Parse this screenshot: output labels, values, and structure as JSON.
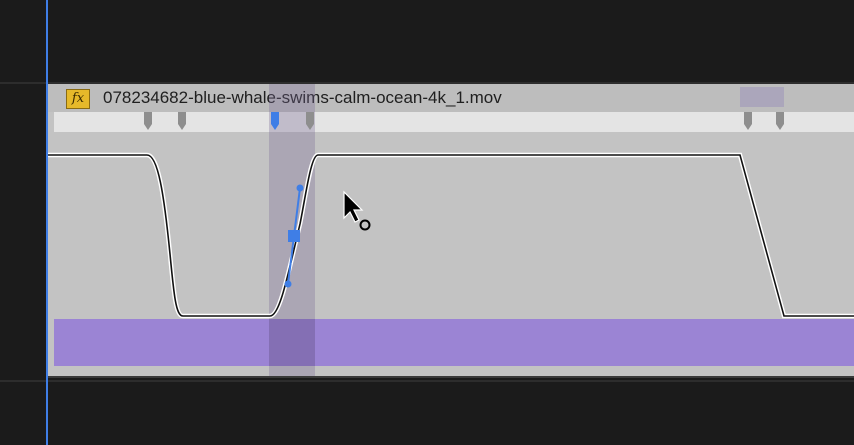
{
  "clip": {
    "name": "078234682-blue-whale-swims-calm-ocean-4k_1.mov",
    "fx_label": "fx",
    "colors": {
      "clip_body": "#c3c3c3",
      "keyframe_strip": "#e4e4e4",
      "audio_waveform": "#9b84d4",
      "fx_badge": "#e6b92a",
      "bezier_handle": "#3f7ee6",
      "playhead": "#3f7ee6"
    }
  },
  "icons": {
    "fx": "fx-badge-icon",
    "cursor": "mouse-pointer-icon",
    "keyframe": "keyframe-marker-icon"
  }
}
